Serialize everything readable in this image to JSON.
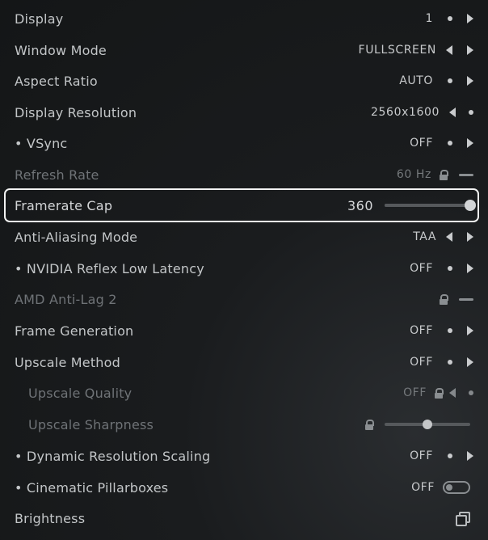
{
  "settings": {
    "display": {
      "label": "Display",
      "value": "1"
    },
    "window_mode": {
      "label": "Window Mode",
      "value": "FULLSCREEN"
    },
    "aspect_ratio": {
      "label": "Aspect Ratio",
      "value": "AUTO"
    },
    "display_resolution": {
      "label": "Display Resolution",
      "value": "2560x1600"
    },
    "vsync": {
      "label": "• VSync",
      "value": "OFF"
    },
    "refresh_rate": {
      "label": "Refresh Rate",
      "value": "60 Hz"
    },
    "framerate_cap": {
      "label": "Framerate Cap",
      "value": "360",
      "slider_fraction": 1.0
    },
    "anti_aliasing": {
      "label": "Anti-Aliasing Mode",
      "value": "TAA"
    },
    "nvidia_reflex": {
      "label": "• NVIDIA Reflex Low Latency",
      "value": "OFF"
    },
    "amd_anti_lag": {
      "label": "AMD Anti-Lag 2"
    },
    "frame_generation": {
      "label": "Frame Generation",
      "value": "OFF"
    },
    "upscale_method": {
      "label": "Upscale Method",
      "value": "OFF"
    },
    "upscale_quality": {
      "label": "Upscale Quality",
      "value": "OFF"
    },
    "upscale_sharpness": {
      "label": "Upscale Sharpness",
      "slider_fraction": 0.5
    },
    "dynamic_resolution": {
      "label": "• Dynamic Resolution Scaling",
      "value": "OFF"
    },
    "cinematic_pillarboxes": {
      "label": "• Cinematic Pillarboxes",
      "value": "OFF",
      "toggle_on": false
    },
    "brightness": {
      "label": "Brightness"
    }
  },
  "colors": {
    "highlight_border": "#f2f2f2",
    "text": "#c3c6c8",
    "dim_text": "#6f7377"
  }
}
